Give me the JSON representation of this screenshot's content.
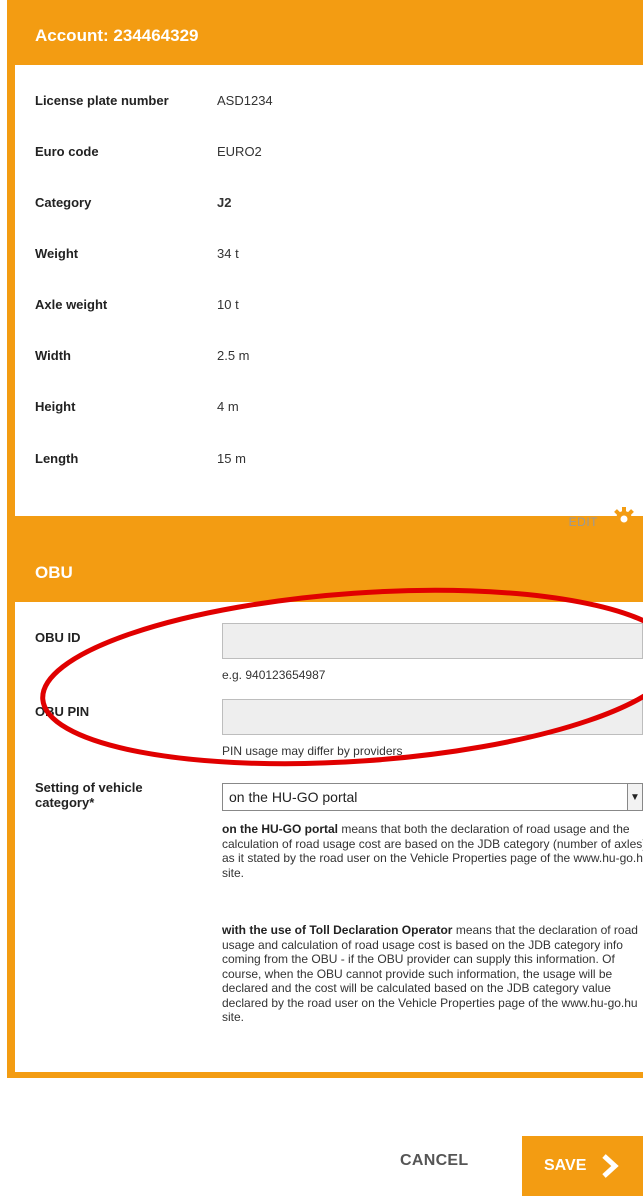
{
  "account": {
    "title": "Account: 234464329",
    "rows": [
      {
        "label": "License plate number",
        "value": "ASD1234"
      },
      {
        "label": "Euro code",
        "value": "EURO2"
      },
      {
        "label": "Category",
        "value": "J2"
      },
      {
        "label": "Weight",
        "value": "34 t"
      },
      {
        "label": "Axle weight",
        "value": "10 t"
      },
      {
        "label": "Width",
        "value": "2.5 m"
      },
      {
        "label": "Height",
        "value": "4 m"
      },
      {
        "label": "Length",
        "value": "15 m"
      }
    ],
    "edit_label": "EDIT"
  },
  "obu": {
    "title": "OBU",
    "obu_id_label": "OBU ID",
    "obu_id_value": "",
    "obu_id_hint": "e.g. 940123654987",
    "obu_pin_label": "OBU PIN",
    "obu_pin_value": "",
    "obu_pin_hint": "PIN usage may differ by providers",
    "category_label": "Setting of vehicle category*",
    "category_selected": "on the HU-GO portal",
    "desc1_bold": "on the HU-GO portal",
    "desc1_text": " means that both the declaration of road usage and the calculation of road usage cost are based on the JDB category (number of axles) as it stated by the road user on the Vehicle Properties page of the www.hu-go.hu site.",
    "desc2_bold": "with the use of Toll Declaration Operator",
    "desc2_text": " means that the declaration of road usage and calculation of road usage cost is based on the JDB category info coming from the OBU - if the OBU provider can supply this information. Of course, when the OBU cannot provide such information, the usage will be declared and the cost will be calculated based on the JDB category value declared by the road user on the Vehicle Properties page of the www.hu-go.hu site."
  },
  "footer": {
    "cancel_label": "CANCEL",
    "save_label": "SAVE"
  },
  "colors": {
    "accent": "#f39c12",
    "annotation": "#e00000"
  },
  "icons": [
    "gear-icon",
    "chevron-right-icon",
    "dropdown-arrow-icon"
  ]
}
